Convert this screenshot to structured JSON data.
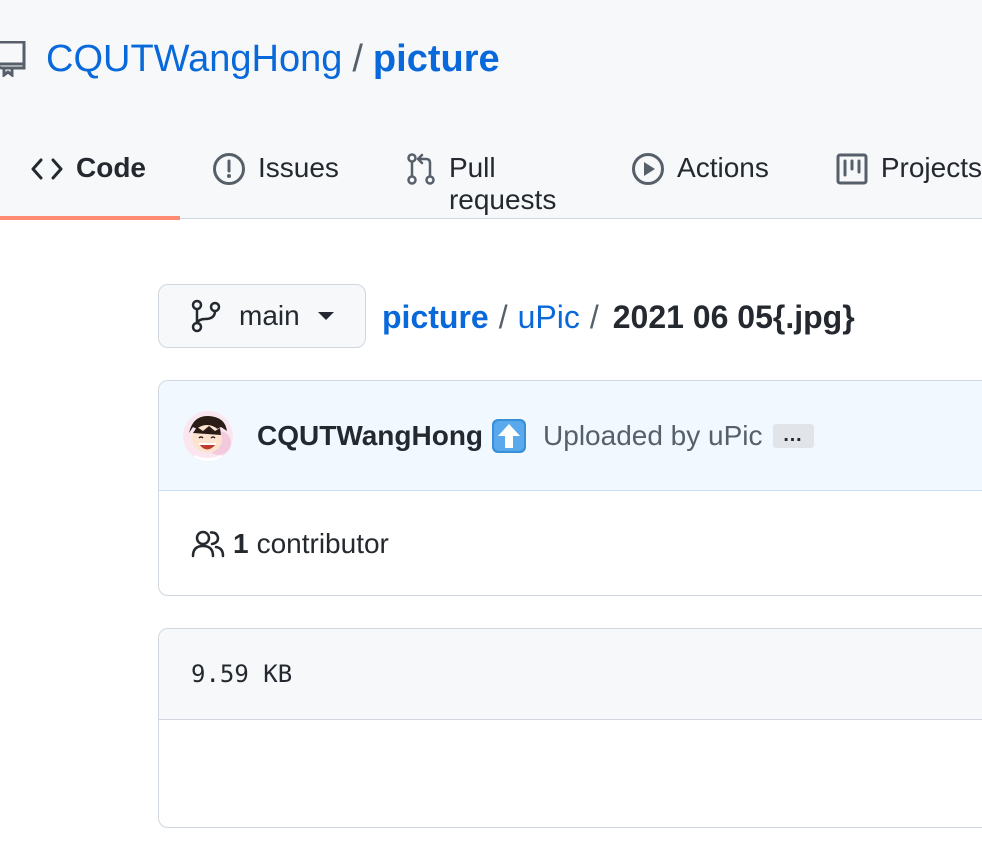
{
  "repo": {
    "owner": "CQUTWangHong",
    "separator": "/",
    "name": "picture"
  },
  "tabs": [
    {
      "label": "Code",
      "icon": "code-icon",
      "selected": true
    },
    {
      "label": "Issues",
      "icon": "issue-opened-icon"
    },
    {
      "label": "Pull requests",
      "icon": "git-pull-request-icon"
    },
    {
      "label": "Actions",
      "icon": "play-icon"
    },
    {
      "label": "Projects",
      "icon": "project-icon"
    }
  ],
  "branch": {
    "name": "main",
    "icon": "git-branch-icon"
  },
  "breadcrumb": {
    "root": "picture",
    "sep": "/",
    "dir": "uPic",
    "file": "2021 06 05{.jpg}"
  },
  "commit": {
    "author": "CQUTWangHong",
    "emoji": "up-arrow-emoji",
    "message": "Uploaded by uPic",
    "more": "…"
  },
  "contributors": {
    "count": "1",
    "label": "contributor",
    "icon": "people-icon"
  },
  "file": {
    "size": "9.59 KB"
  },
  "colors": {
    "link": "#0969da",
    "tab_underline": "#fd8c73",
    "commit_bg": "#f1f8ff"
  }
}
